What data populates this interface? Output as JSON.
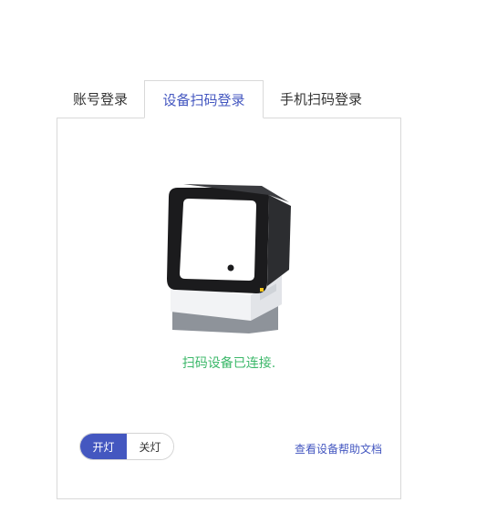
{
  "tabs": [
    {
      "label": "账号登录",
      "active": false
    },
    {
      "label": "设备扫码登录",
      "active": true
    },
    {
      "label": "手机扫码登录",
      "active": false
    }
  ],
  "panel": {
    "device_icon": "scanner-device-image",
    "status_text": "扫码设备已连接.",
    "light_toggle": {
      "on_label": "开灯",
      "off_label": "关灯",
      "selected": "开灯"
    },
    "help_link": "查看设备帮助文档"
  },
  "colors": {
    "accent": "#4457c0",
    "success": "#3cb86a",
    "border": "#d9d9d9"
  }
}
